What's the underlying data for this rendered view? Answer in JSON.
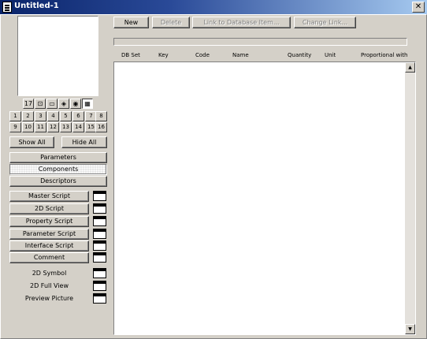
{
  "window": {
    "title": "Untitled-1",
    "close": "✕"
  },
  "toolbar": {
    "new": "New",
    "delete": "Delete",
    "link": "Link to Database Item...",
    "change_link": "Change Link..."
  },
  "view_icons": [
    "17",
    "⊡",
    "▭",
    "◈",
    "◉",
    "▦"
  ],
  "num_row1": [
    "1",
    "2",
    "3",
    "4",
    "5",
    "6",
    "7",
    "8"
  ],
  "num_row2": [
    "9",
    "10",
    "11",
    "12",
    "13",
    "14",
    "15",
    "16"
  ],
  "show_all": "Show All",
  "hide_all": "Hide All",
  "sections": [
    "Parameters",
    "Components",
    "Descriptors"
  ],
  "scripts": [
    "Master Script",
    "2D Script",
    "Property Script",
    "Parameter Script",
    "Interface Script",
    "Comment"
  ],
  "views": [
    "2D Symbol",
    "2D Full View",
    "Preview Picture"
  ],
  "columns": [
    "DB Set",
    "Key",
    "Code",
    "Name",
    "Quantity",
    "Unit",
    "Proportional with"
  ],
  "scroll": {
    "up": "▲",
    "down": "▼"
  }
}
